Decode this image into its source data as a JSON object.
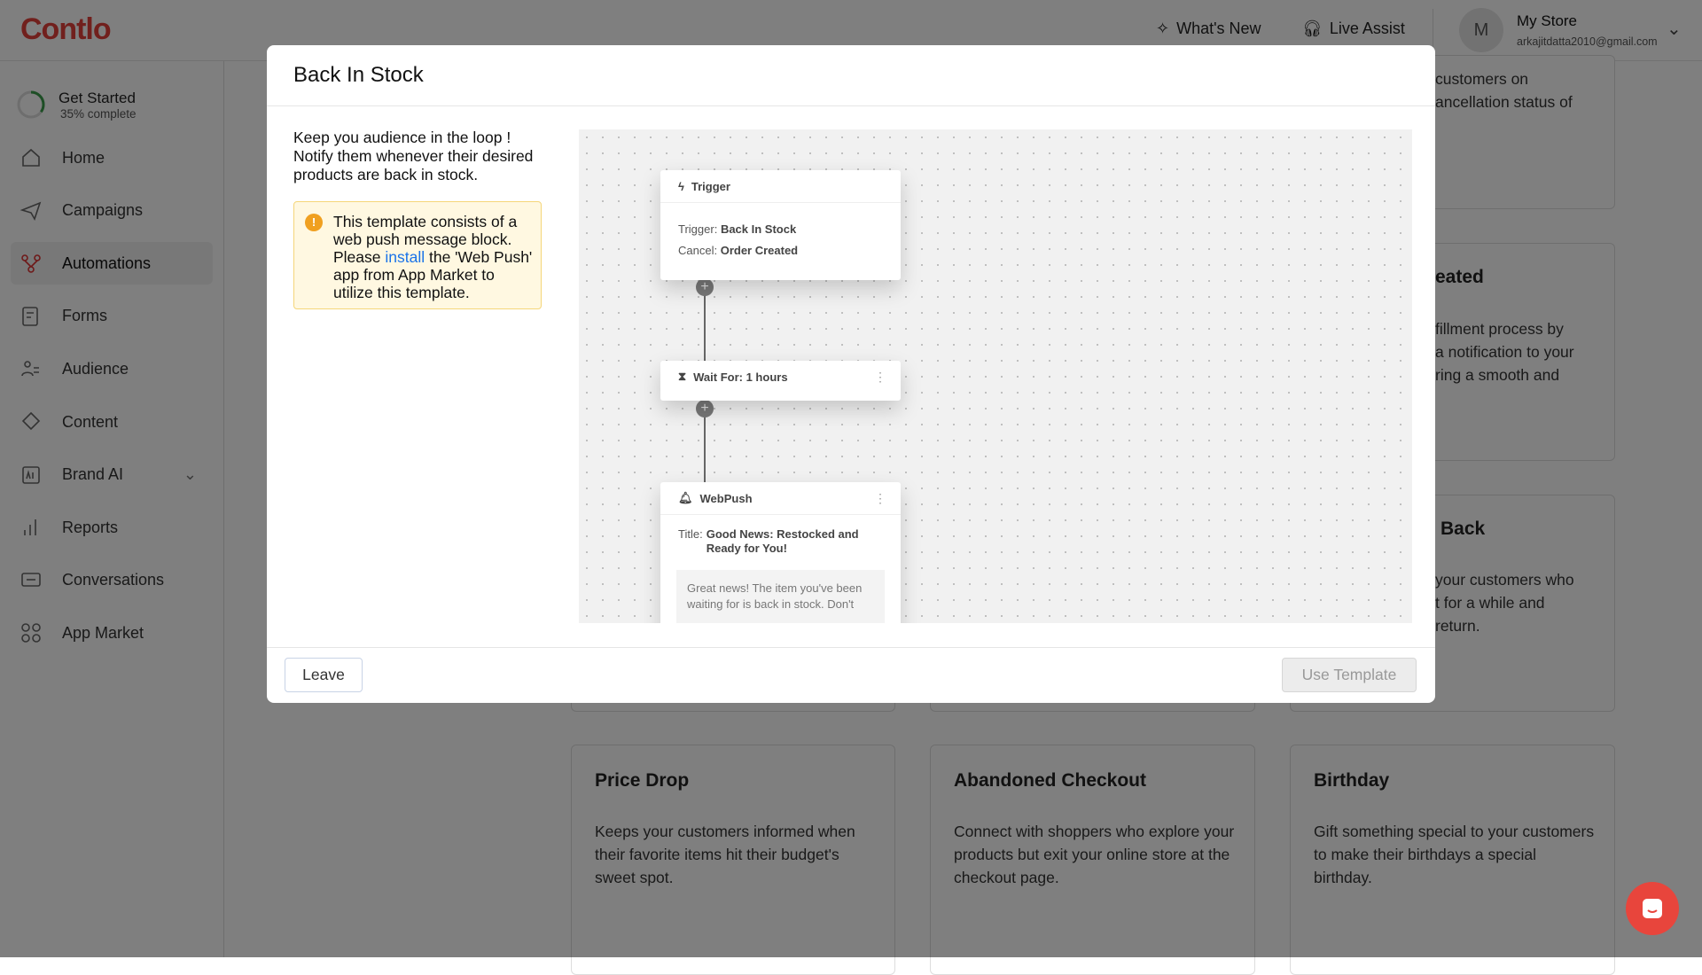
{
  "app": {
    "logo": "Contlo",
    "brand_color": "#e2403a"
  },
  "header": {
    "whats_new": "What's New",
    "live_assist": "Live Assist",
    "avatar_initial": "M",
    "store_name": "My Store",
    "email": "arkajitdatta2010@gmail.com"
  },
  "sidebar": {
    "get_started": {
      "title": "Get Started",
      "progress_label": "35% complete",
      "progress": 0.35
    },
    "items": [
      {
        "label": "Home",
        "icon": "home-icon"
      },
      {
        "label": "Campaigns",
        "icon": "paper-plane-icon"
      },
      {
        "label": "Automations",
        "icon": "automation-icon",
        "active": true
      },
      {
        "label": "Forms",
        "icon": "form-icon"
      },
      {
        "label": "Audience",
        "icon": "users-icon"
      },
      {
        "label": "Content",
        "icon": "content-icon"
      },
      {
        "label": "Brand AI",
        "icon": "ai-icon",
        "expandable": true
      },
      {
        "label": "Reports",
        "icon": "bar-chart-icon"
      },
      {
        "label": "Conversations",
        "icon": "chat-icon"
      },
      {
        "label": "App Market",
        "icon": "grid-icon"
      }
    ]
  },
  "background_cards": {
    "partial": [
      {
        "title": "",
        "lines": [
          "customers on",
          "ancellation status of"
        ]
      },
      {
        "title": "eated",
        "lines": [
          "fillment process by",
          "a notification to your",
          "ring a smooth and"
        ]
      },
      {
        "title": "Back",
        "lines": [
          "your customers who",
          "t for a while and",
          "return."
        ]
      }
    ],
    "cards": [
      {
        "title": "Price Drop",
        "text": "Keeps your customers informed when their favorite items hit their budget's sweet spot."
      },
      {
        "title": "Abandoned Checkout",
        "text": "Connect with shoppers who explore your products but exit your online store at the checkout page."
      },
      {
        "title": "Birthday",
        "text": "Gift something special to your customers to make their birthdays a special birthday."
      }
    ]
  },
  "modal": {
    "title": "Back In Stock",
    "description": "Keep you audience in the loop ! Notify them whenever their desired products are back in stock.",
    "warning": {
      "before": "This template consists of a web push message block. Please ",
      "link": "install",
      "after": " the 'Web Push' app from App Market to utilize this template."
    },
    "flow": {
      "trigger": {
        "header": "Trigger",
        "trigger_label": "Trigger:",
        "trigger_value": "Back In Stock",
        "cancel_label": "Cancel:",
        "cancel_value": "Order Created"
      },
      "wait": {
        "label": "Wait For: 1 hours"
      },
      "webpush": {
        "header": "WebPush",
        "title_label": "Title:",
        "title_value": "Good News: Restocked and Ready for You!",
        "body": "Great news! The item you've been waiting for is back in stock. Don't"
      }
    },
    "leave": "Leave",
    "use_template": "Use Template"
  }
}
